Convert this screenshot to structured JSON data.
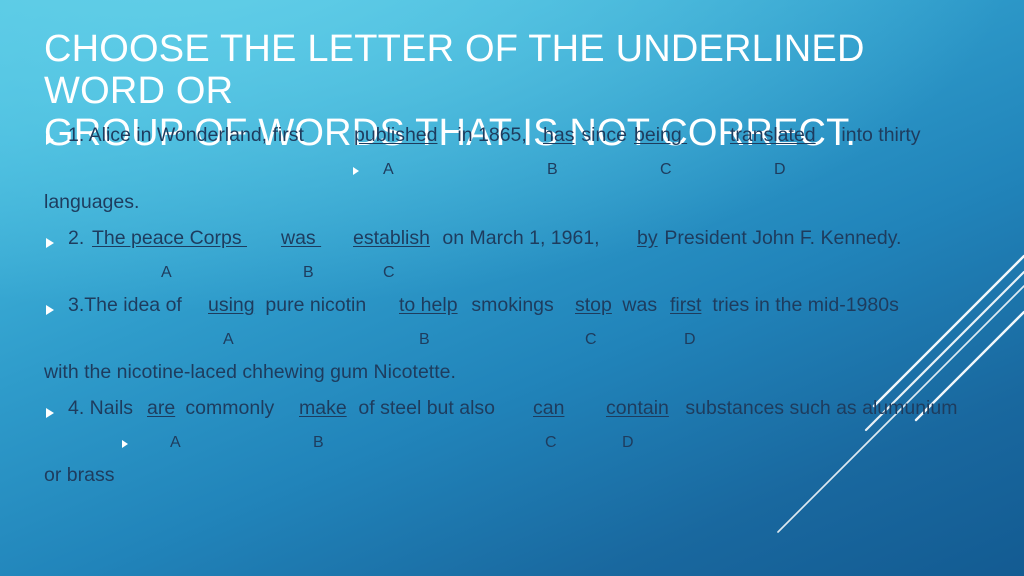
{
  "slide": {
    "title": "CHOOSE THE LETTER OF THE UNDERLINED WORD OR\nGROUP OF WORDS THAT IS NOT CORRECT.",
    "colors": {
      "background_top": "#4ec4e2",
      "background_bottom": "#135b92",
      "title_text": "#ffffff",
      "body_text": "#1e3c5e",
      "bullet": "#ffffff",
      "decor_line": "#ffffff"
    },
    "questions": [
      {
        "number": "1.",
        "q1_a": "1. Alice in Wonderland, first ",
        "q1_b": "published",
        "q1_c": " in 1865, ",
        "q1_d": "has",
        "q1_e": " since ",
        "q1_f": "being ",
        "q1_g": "   ",
        "q1_h": "translated",
        "q1_i": " into thirty",
        "continuation": "languages.",
        "answers": [
          "A",
          "B",
          "C",
          "D"
        ]
      },
      {
        "number": "2.",
        "q2_a": "2. ",
        "q2_b": "The peace Corps ",
        "q2_c": "  ",
        "q2_d": "was ",
        "q2_e": "   ",
        "q2_f": "establish",
        "q2_g": " on March 1, 1961, ",
        "q2_h": "by",
        "q2_i": " President John F. Kennedy.",
        "answers": [
          "A",
          "B",
          "C"
        ]
      },
      {
        "number": "3.",
        "q3_a": "3.The idea of ",
        "q3_b": "using",
        "q3_c": " pure nicotin ",
        "q3_d": "to help",
        "q3_e": " smokings ",
        "q3_f": "stop",
        "q3_g": " was ",
        "q3_h": "first",
        "q3_i": " tries in the mid-1980s",
        "continuation": "with the nicotine-laced chhewing gum Nicotette.",
        "answers": [
          "A",
          "B",
          "C",
          "D"
        ]
      },
      {
        "number": "4.",
        "q4_a": "4. Nails ",
        "q4_b": "are",
        "q4_c": " commonly ",
        "q4_d": "make",
        "q4_e": " of steel but also ",
        "q4_f": "can",
        "q4_g": "   ",
        "q4_h": "contain",
        "q4_i": " substances such as alumunium",
        "continuation": "or brass",
        "answers": [
          "A",
          "B",
          "C",
          "D"
        ]
      }
    ]
  }
}
